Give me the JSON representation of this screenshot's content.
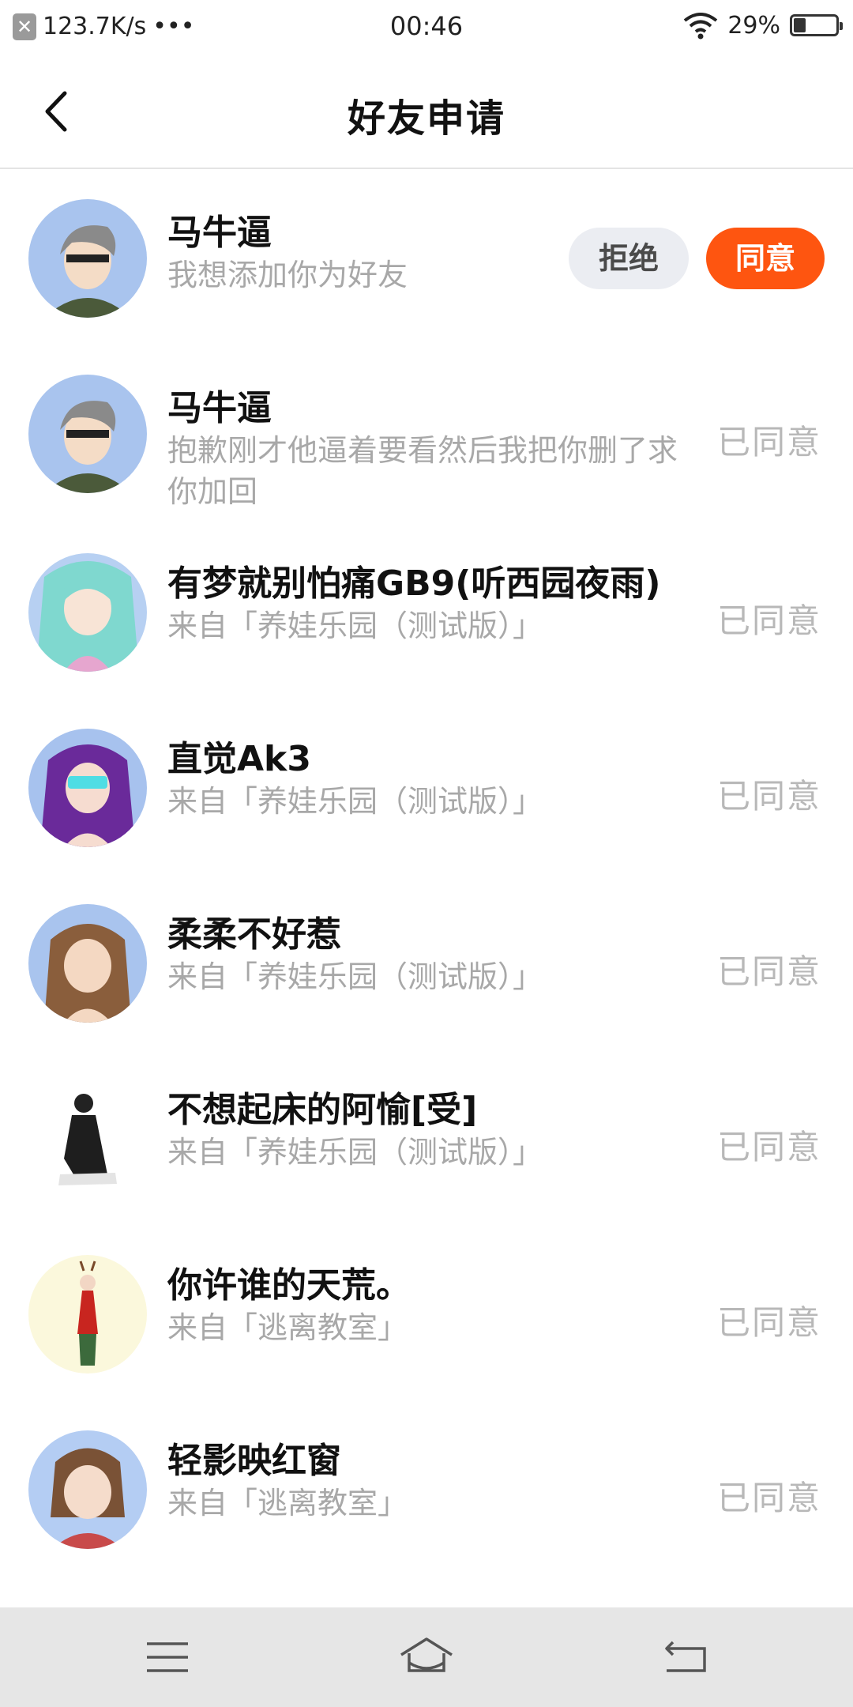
{
  "status_bar": {
    "notification_icon": "close-x-icon",
    "network_speed": "123.7K/s",
    "more": "•••",
    "time": "00:46",
    "battery_text": "29%",
    "battery_level": 0.29
  },
  "header": {
    "title": "好友申请",
    "back_icon": "chevron-left-icon"
  },
  "requests": [
    {
      "name": "马牛逼",
      "message": "我想添加你为好友",
      "status": "",
      "reject_label": "拒绝",
      "accept_label": "同意",
      "avatar_color": "#a9c4ee"
    },
    {
      "name": "马牛逼",
      "message": "抱歉刚才他逼着要看然后我把你删了求你加回",
      "status": "已同意",
      "avatar_color": "#a9c4ee"
    },
    {
      "name": "有梦就别怕痛GB9(听西园夜雨)",
      "message": "来自「养娃乐园（测试版）」",
      "status": "已同意",
      "avatar_color": "#b7d0f2"
    },
    {
      "name": "直觉Ak3",
      "message": "来自「养娃乐园（测试版）」",
      "status": "已同意",
      "avatar_color": "#a7c2ee"
    },
    {
      "name": "柔柔不好惹",
      "message": "来自「养娃乐园（测试版）」",
      "status": "已同意",
      "avatar_color": "#a9c4ee"
    },
    {
      "name": "不想起床的阿愉[受]",
      "message": "来自「养娃乐园（测试版）」",
      "status": "已同意",
      "avatar_color": "#ffffff"
    },
    {
      "name": "你许谁的天荒。",
      "message": "来自「逃离教室」",
      "status": "已同意",
      "avatar_color": "#fbf8dc"
    },
    {
      "name": "轻影映红窗",
      "message": "来自「逃离教室」",
      "status": "已同意",
      "avatar_color": "#b4cdf3"
    }
  ],
  "nav_bar": {
    "menu_icon": "menu-icon",
    "home_icon": "home-icon",
    "back_icon": "back-arrow-icon"
  },
  "colors": {
    "accent": "#fe5510",
    "reject_bg": "#ebedf2",
    "muted_text": "#a8a8a8"
  }
}
